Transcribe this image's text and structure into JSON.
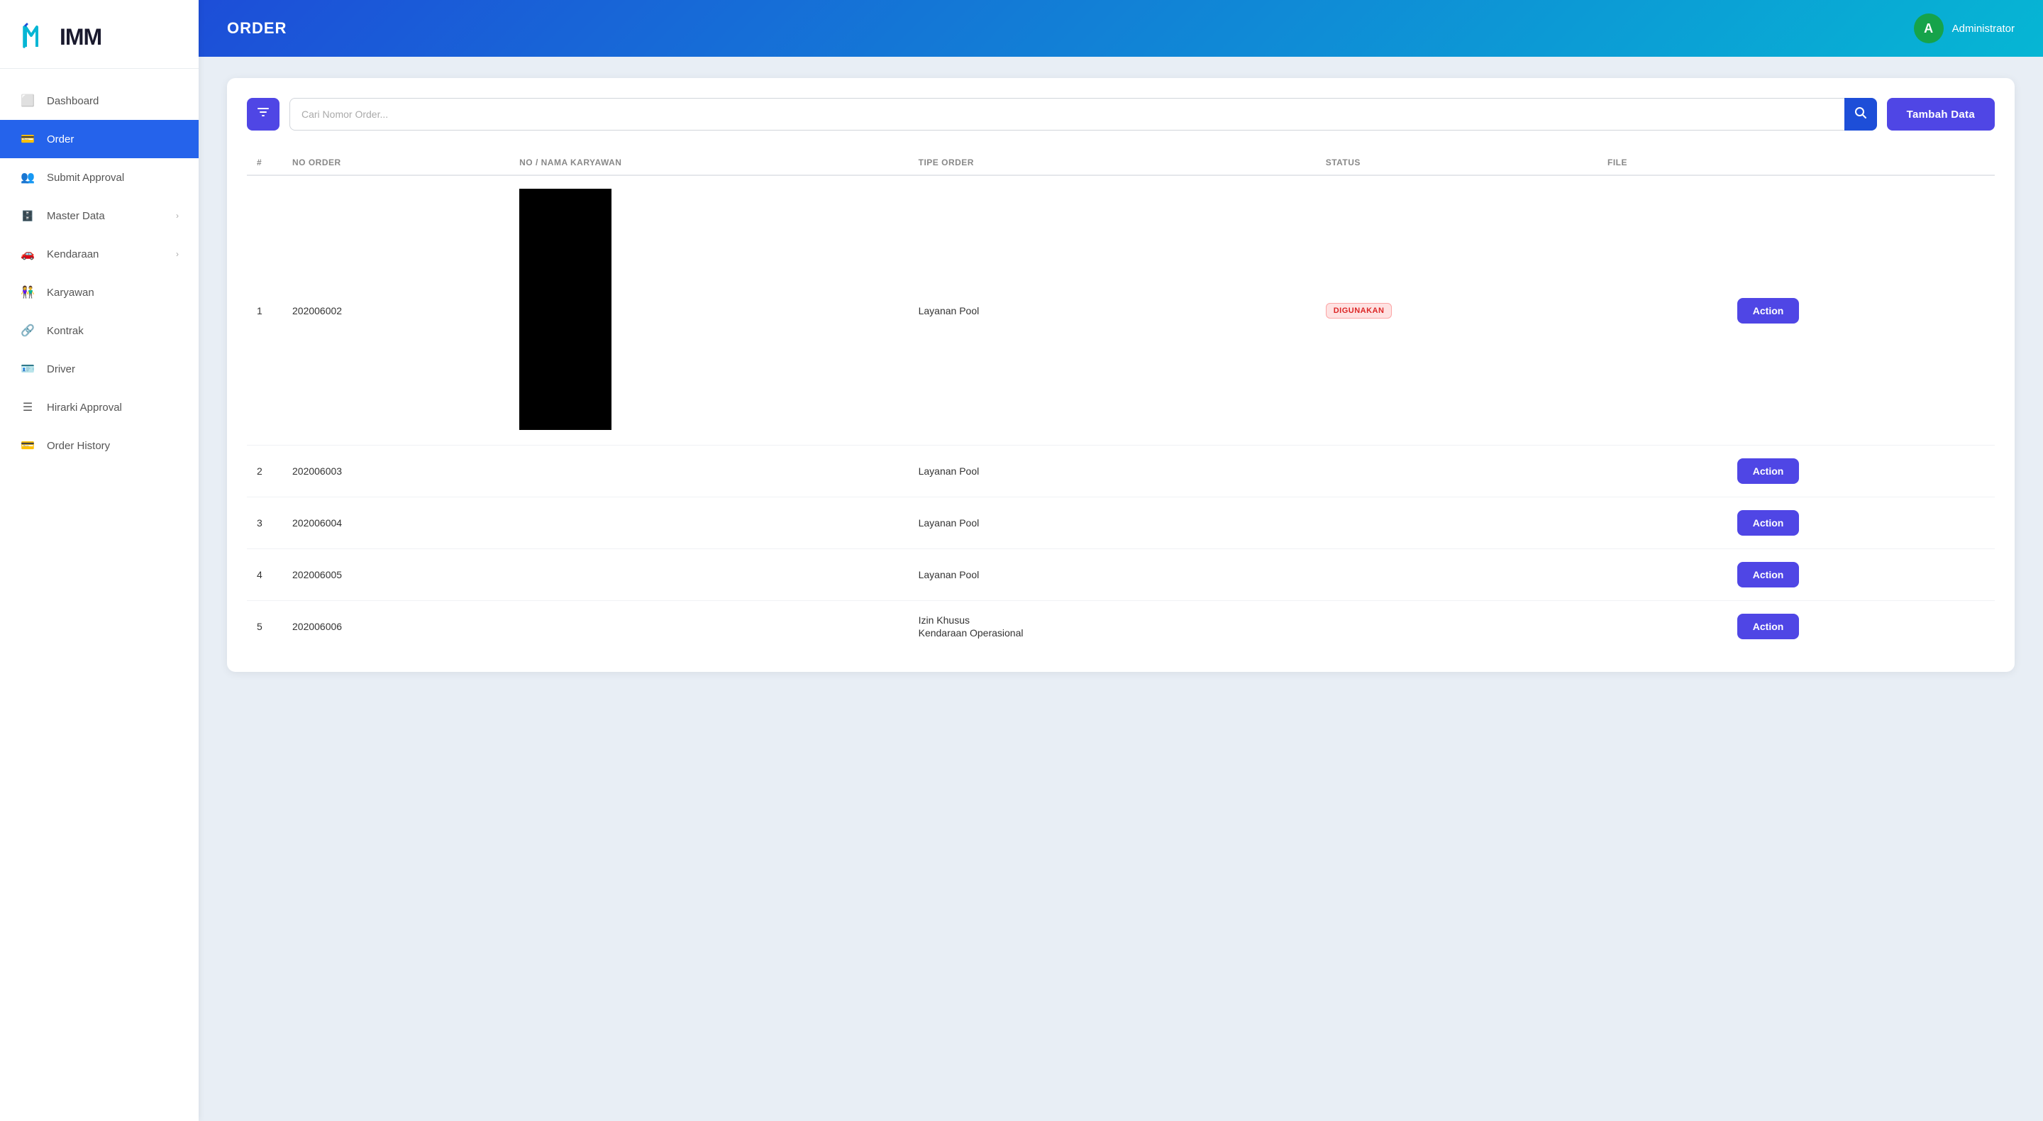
{
  "sidebar": {
    "logo": "IMM",
    "items": [
      {
        "id": "dashboard",
        "label": "Dashboard",
        "icon": "monitor-icon",
        "active": false,
        "hasChevron": false
      },
      {
        "id": "order",
        "label": "Order",
        "icon": "order-icon",
        "active": true,
        "hasChevron": false
      },
      {
        "id": "submit-approval",
        "label": "Submit Approval",
        "icon": "approval-icon",
        "active": false,
        "hasChevron": false
      },
      {
        "id": "master-data",
        "label": "Master Data",
        "icon": "masterdata-icon",
        "active": false,
        "hasChevron": true
      },
      {
        "id": "kendaraan",
        "label": "Kendaraan",
        "icon": "kendaraan-icon",
        "active": false,
        "hasChevron": true
      },
      {
        "id": "karyawan",
        "label": "Karyawan",
        "icon": "karyawan-icon",
        "active": false,
        "hasChevron": false
      },
      {
        "id": "kontrak",
        "label": "Kontrak",
        "icon": "kontrak-icon",
        "active": false,
        "hasChevron": false
      },
      {
        "id": "driver",
        "label": "Driver",
        "icon": "driver-icon",
        "active": false,
        "hasChevron": false
      },
      {
        "id": "hirarki-approval",
        "label": "Hirarki Approval",
        "icon": "hirarki-icon",
        "active": false,
        "hasChevron": false
      },
      {
        "id": "order-history",
        "label": "Order History",
        "icon": "history-icon",
        "active": false,
        "hasChevron": false
      }
    ]
  },
  "header": {
    "title": "ORDER",
    "user": {
      "avatar_letter": "A",
      "name": "Administrator"
    }
  },
  "toolbar": {
    "search_placeholder": "Cari Nomor Order...",
    "add_button_label": "Tambah Data"
  },
  "table": {
    "columns": [
      "#",
      "NO ORDER",
      "NO / NAMA KARYAWAN",
      "TIPE ORDER",
      "STATUS",
      "FILE",
      ""
    ],
    "rows": [
      {
        "no": "1",
        "no_order": "202006002",
        "karyawan": "[REDACTED]",
        "tipe_order": "Layanan Pool",
        "tipe_order_line2": "",
        "status": "DIGUNAKAN",
        "file": "",
        "action": "Action"
      },
      {
        "no": "2",
        "no_order": "202006003",
        "karyawan": "[REDACTED]",
        "tipe_order": "Layanan Pool",
        "tipe_order_line2": "",
        "status": "",
        "file": "",
        "action": "Action"
      },
      {
        "no": "3",
        "no_order": "202006004",
        "karyawan": "[REDACTED]",
        "tipe_order": "Layanan Pool",
        "tipe_order_line2": "",
        "status": "",
        "file": "",
        "action": "Action"
      },
      {
        "no": "4",
        "no_order": "202006005",
        "karyawan": "[REDACTED]",
        "tipe_order": "Layanan Pool",
        "tipe_order_line2": "",
        "status": "",
        "file": "",
        "action": "Action"
      },
      {
        "no": "5",
        "no_order": "202006006",
        "karyawan": "[REDACTED]",
        "tipe_order": "Izin Khusus",
        "tipe_order_line2": "Kendaraan Operasional",
        "status": "",
        "file": "",
        "action": "Action"
      }
    ]
  }
}
